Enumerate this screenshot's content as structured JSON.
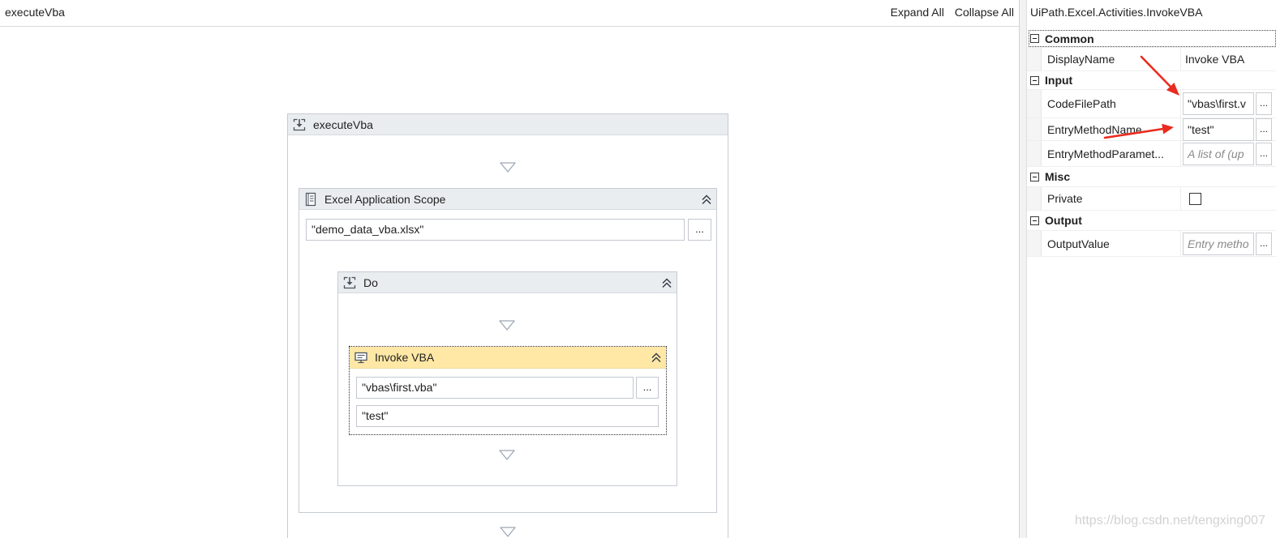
{
  "designer": {
    "breadcrumb": "executeVba",
    "expand_all": "Expand All",
    "collapse_all": "Collapse All",
    "sequence": {
      "title": "executeVba",
      "icon": "sequence-icon",
      "scope": {
        "title": "Excel Application Scope",
        "icon": "excel-application-scope-icon",
        "workbook_path": "\"demo_data_vba.xlsx\"",
        "browse_label": "...",
        "body": {
          "title": "Do",
          "icon": "sequence-icon",
          "invoke_vba": {
            "title": "Invoke VBA",
            "icon": "invoke-vba-icon",
            "code_file_path": "\"vbas\\first.vba\"",
            "browse_label": "...",
            "entry_method_name": "\"test\""
          }
        }
      }
    }
  },
  "properties": {
    "title": "UiPath.Excel.Activities.InvokeVBA",
    "categories": [
      {
        "name": "Common",
        "rows": [
          {
            "label": "DisplayName",
            "value": "Invoke VBA"
          }
        ]
      },
      {
        "name": "Input",
        "rows": [
          {
            "label": "CodeFilePath",
            "value": "\"vbas\\first.v",
            "browse_label": "..."
          },
          {
            "label": "EntryMethodName",
            "value": "\"test\"",
            "browse_label": "..."
          },
          {
            "label": "EntryMethodParamet...",
            "placeholder": "A list of (up",
            "browse_label": "..."
          }
        ]
      },
      {
        "name": "Misc",
        "rows": [
          {
            "label": "Private",
            "checked": false
          }
        ]
      },
      {
        "name": "Output",
        "rows": [
          {
            "label": "OutputValue",
            "placeholder": "Entry metho",
            "browse_label": "..."
          }
        ]
      }
    ]
  },
  "watermark": "https://blog.csdn.net/tengxing007",
  "colors": {
    "activity_header": "#eaedf0",
    "selected_activity_header": "#ffe8a6",
    "annotation_arrow": "#ea2b1f",
    "watermark_text": "#d2d2d2"
  }
}
